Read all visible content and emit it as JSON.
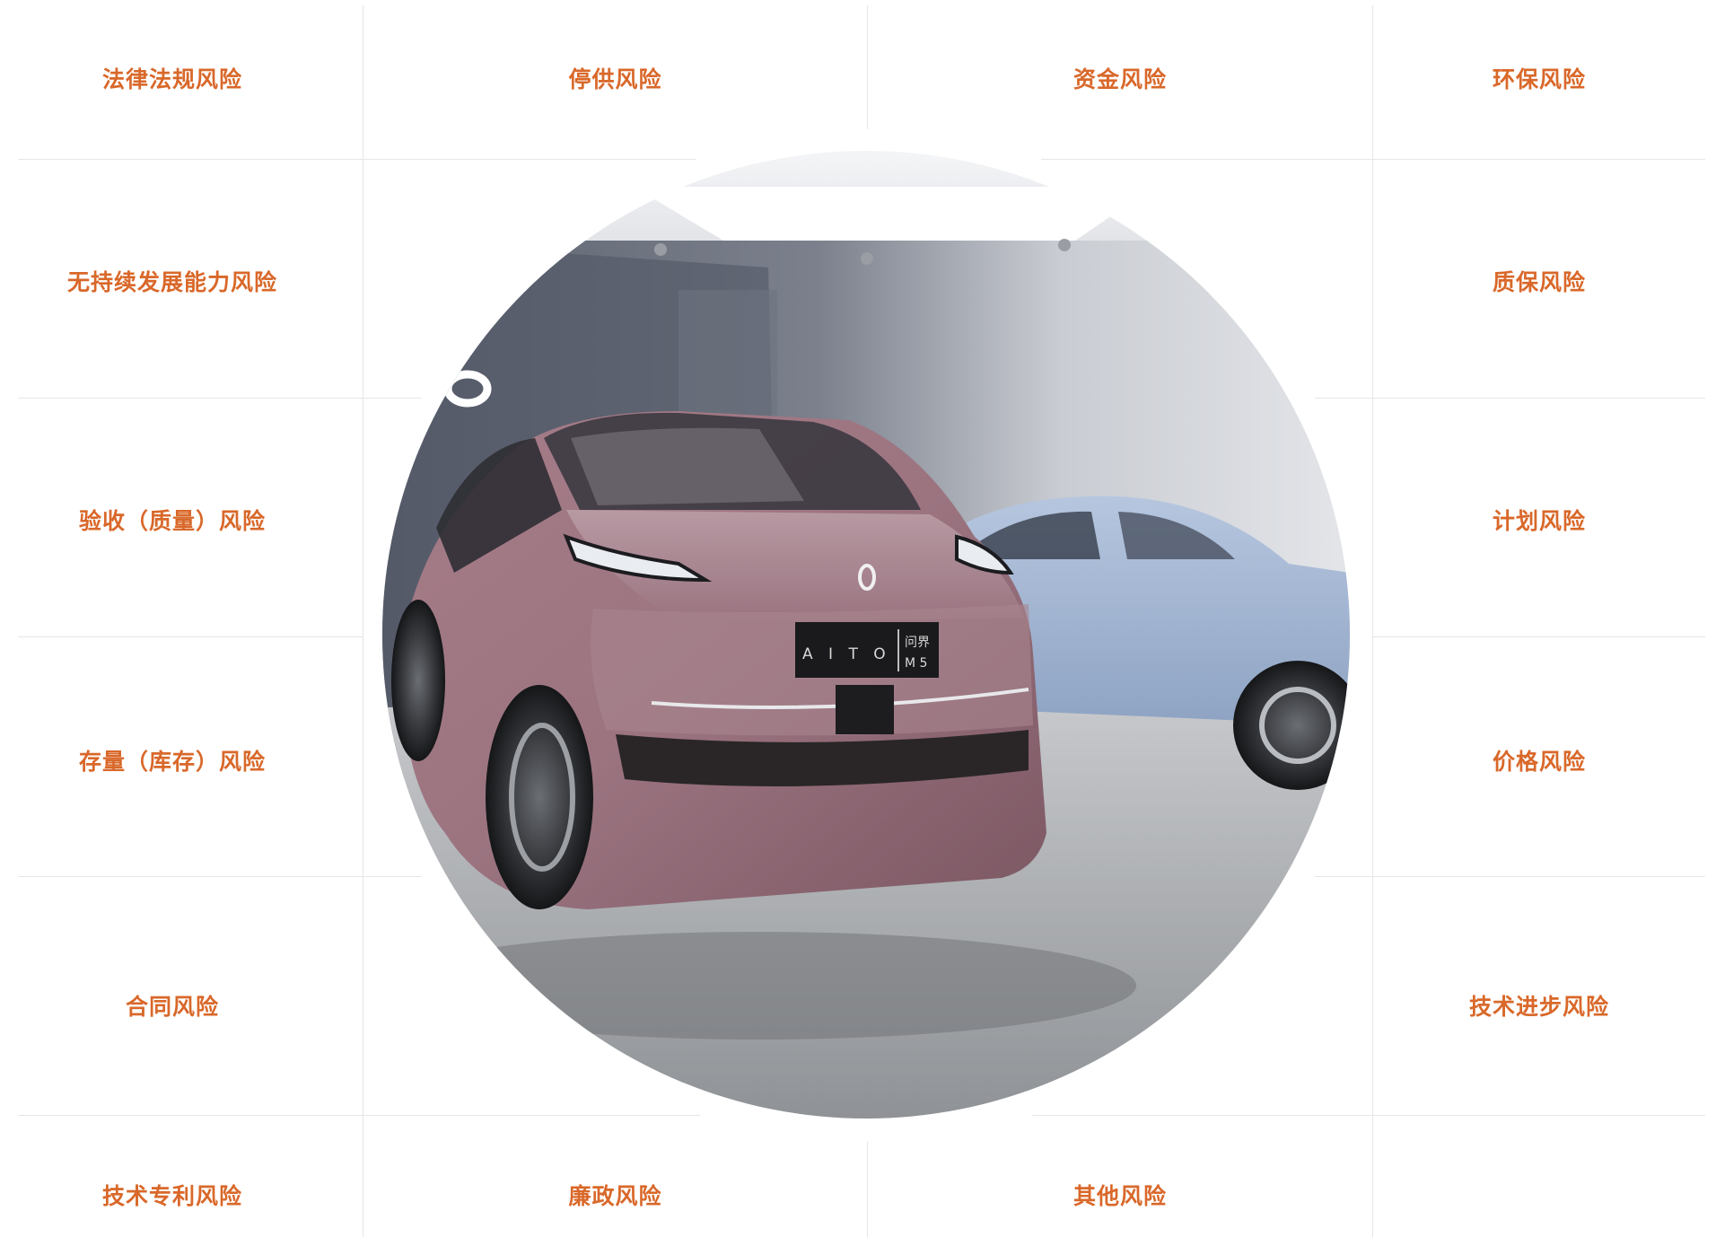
{
  "grid": {
    "line_color": "#e6e6e6"
  },
  "accent_color": "#d9682a",
  "risks": {
    "legal": "法律法规风险",
    "supply_stop": "停供风险",
    "funds": "资金风险",
    "environmental": "环保风险",
    "sustainability": "无持续发展能力风险",
    "warranty": "质保风险",
    "acceptance": "验收（质量）风险",
    "plan": "计划风险",
    "inventory": "存量（库存）风险",
    "price": "价格风险",
    "contract": "合同风险",
    "tech_progress": "技术进步风险",
    "patent": "技术专利风险",
    "integrity": "廉政风险",
    "other": "其他风险"
  },
  "photo": {
    "plate_brand": "A I T O",
    "plate_model_cn": "问界",
    "plate_model": "M 5",
    "icon": "car-showroom-photo"
  }
}
